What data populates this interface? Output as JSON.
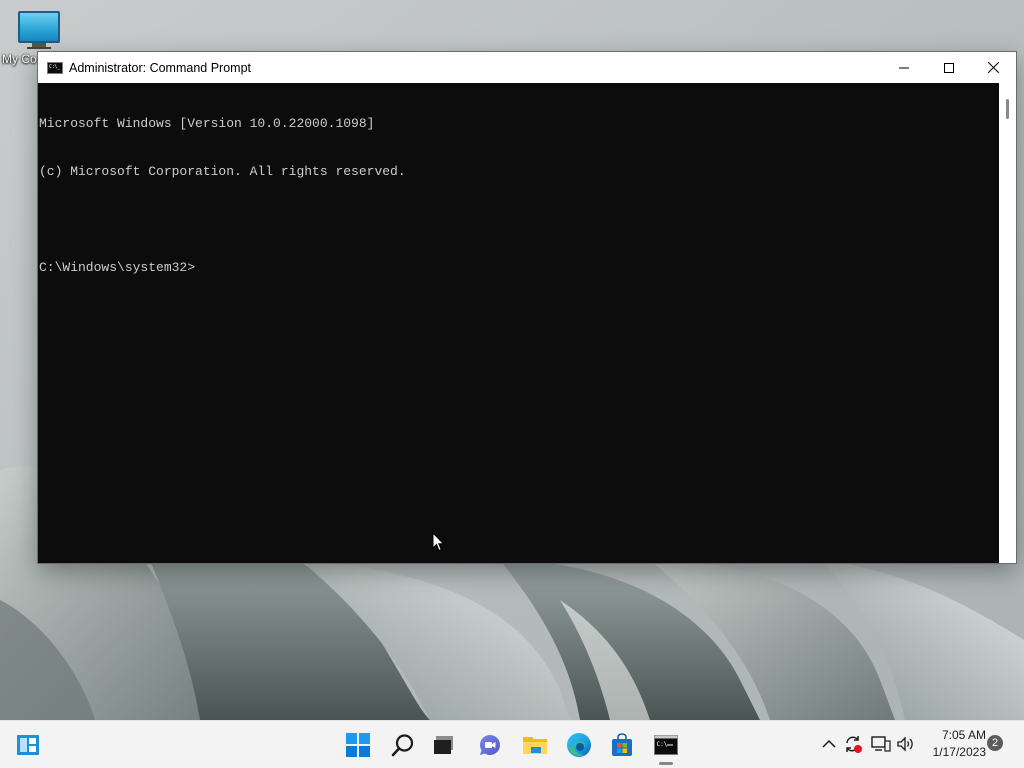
{
  "desktop": {
    "icons": [
      {
        "label": "My Co",
        "icon": "computer-monitor-icon"
      }
    ]
  },
  "window": {
    "title": "Administrator:  Command Prompt",
    "icon": "command-prompt-icon",
    "icon_glyph": "C:\\_",
    "controls": {
      "minimize": "minimize-icon",
      "maximize": "maximize-icon",
      "close": "close-icon"
    },
    "console_lines": [
      "Microsoft Windows [Version 10.0.22000.1098]",
      "(c) Microsoft Corporation. All rights reserved.",
      "",
      "C:\\Windows\\system32>"
    ]
  },
  "taskbar": {
    "left_widget_icon": "widgets-icon",
    "apps": [
      {
        "name": "start",
        "icon": "windows-start-icon",
        "active": false
      },
      {
        "name": "search",
        "icon": "search-icon",
        "active": false
      },
      {
        "name": "task-view",
        "icon": "task-view-icon",
        "active": false
      },
      {
        "name": "chat",
        "icon": "teams-chat-icon",
        "active": false
      },
      {
        "name": "file-explorer",
        "icon": "folder-icon",
        "active": false
      },
      {
        "name": "edge",
        "icon": "edge-browser-icon",
        "active": false
      },
      {
        "name": "store",
        "icon": "microsoft-store-icon",
        "active": false
      },
      {
        "name": "command-prompt",
        "icon": "command-prompt-icon",
        "active": true
      }
    ],
    "tray": {
      "icons": [
        "chevron-up-icon",
        "sync-error-icon",
        "network-icon",
        "volume-icon"
      ],
      "time": "7:05 AM",
      "date": "1/17/2023",
      "notification_count": "2"
    }
  },
  "colors": {
    "console_bg": "#0c0c0c",
    "console_text": "#cccccc",
    "taskbar_bg": "#f3f3f3",
    "titlebar_bg": "#ffffff"
  }
}
